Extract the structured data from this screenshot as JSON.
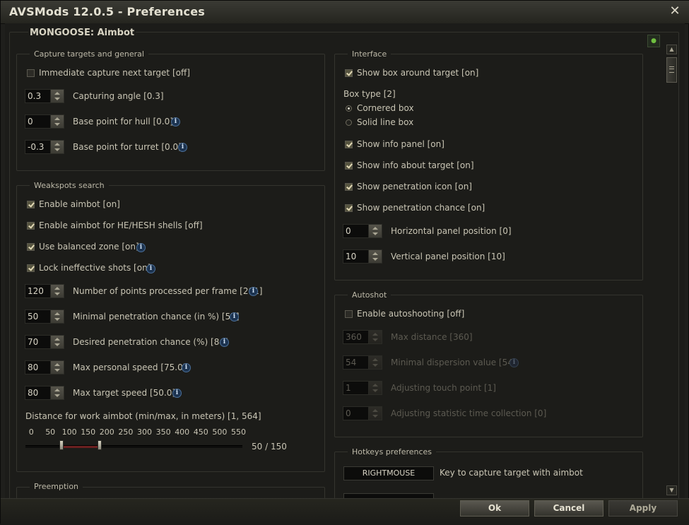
{
  "window": {
    "title": "AVSMods 12.0.5 - Preferences",
    "close": "✕"
  },
  "section_title": "MONGOOSE: Aimbot",
  "capture": {
    "label": "Capture targets and general",
    "immediate": {
      "label": "Immediate capture next target [off]",
      "checked": false
    },
    "angle": {
      "value": "0.3",
      "label": "Capturing angle [0.3]"
    },
    "hull": {
      "value": "0",
      "label": "Base point for hull [0.0]"
    },
    "turret": {
      "value": "-0.3",
      "label": "Base point for turret [0.0]"
    }
  },
  "weak": {
    "label": "Weakspots search",
    "enable": "Enable aimbot [on]",
    "he": "Enable aimbot for HE/HESH shells [off]",
    "balanced": "Use balanced zone [on]",
    "lock": "Lock ineffective shots [on]",
    "points": {
      "value": "120",
      "label": "Number of points processed per frame [201]"
    },
    "minpen": {
      "value": "50",
      "label": "Minimal penetration chance (in %) [57]"
    },
    "despen": {
      "value": "70",
      "label": "Desired penetration chance (%) [84]"
    },
    "maxpers": {
      "value": "80",
      "label": "Max personal speed [75.0]"
    },
    "maxtarget": {
      "value": "80",
      "label": "Max target speed [50.0]"
    },
    "distance_label": "Distance for work aimbot (min/max, in meters) [1, 564]",
    "ticks": [
      "0",
      "50",
      "100",
      "150",
      "200",
      "250",
      "300",
      "350",
      "400",
      "450",
      "500",
      "550"
    ],
    "range_value": "50 / 150",
    "range_min": 50,
    "range_max": 150
  },
  "preemption": {
    "label": "Preemption"
  },
  "interface": {
    "label": "Interface",
    "showbox": "Show box around target [on]",
    "boxtype": "Box type [2]",
    "cornered": "Cornered box",
    "solid": "Solid line box",
    "infopanel": "Show info panel [on]",
    "infotarget": "Show info about target [on]",
    "penicon": "Show penetration icon [on]",
    "penchance": "Show penetration chance [on]",
    "hpos": {
      "value": "0",
      "label": "Horizontal panel position [0]"
    },
    "vpos": {
      "value": "10",
      "label": "Vertical panel position [10]"
    }
  },
  "autoshot": {
    "label": "Autoshot",
    "enable": "Enable autoshooting [off]",
    "maxdist": {
      "value": "360",
      "label": "Max distance [360]"
    },
    "mindisp": {
      "value": "54",
      "label": "Minimal dispersion value [54]"
    },
    "touch": {
      "value": "1",
      "label": "Adjusting touch point [1]"
    },
    "stat": {
      "value": "0",
      "label": "Adjusting statistic time collection [0]"
    }
  },
  "hotkeys": {
    "label": "Hotkeys preferences",
    "key1": "RIGHTMOUSE",
    "key1_label": "Key to capture target with aimbot"
  },
  "buttons": {
    "ok": "Ok",
    "cancel": "Cancel",
    "apply": "Apply"
  },
  "info_glyph": "i"
}
